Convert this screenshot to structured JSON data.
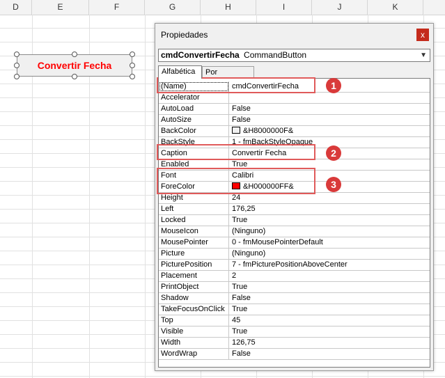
{
  "sheet": {
    "columns": [
      "D",
      "E",
      "F",
      "G",
      "H",
      "I",
      "J",
      "K"
    ],
    "button_caption": "Convertir Fecha",
    "button_color": "#ff0000"
  },
  "window": {
    "title": "Propiedades",
    "close_glyph": "x",
    "object_name": "cmdConvertirFecha",
    "object_type": "CommandButton",
    "tabs": [
      "Alfabética",
      "Por categorías"
    ]
  },
  "properties": [
    {
      "name": "(Name)",
      "value": "cmdConvertirFecha"
    },
    {
      "name": "Accelerator",
      "value": ""
    },
    {
      "name": "AutoLoad",
      "value": "False"
    },
    {
      "name": "AutoSize",
      "value": "False"
    },
    {
      "name": "BackColor",
      "value": "&H8000000F&",
      "swatch": "#f0f0f0"
    },
    {
      "name": "BackStyle",
      "value": "1 - fmBackStyleOpaque"
    },
    {
      "name": "Caption",
      "value": "Convertir Fecha"
    },
    {
      "name": "Enabled",
      "value": "True"
    },
    {
      "name": "Font",
      "value": "Calibri"
    },
    {
      "name": "ForeColor",
      "value": "&H000000FF&",
      "swatch": "#ff0000"
    },
    {
      "name": "Height",
      "value": "24"
    },
    {
      "name": "Left",
      "value": "176,25"
    },
    {
      "name": "Locked",
      "value": "True"
    },
    {
      "name": "MouseIcon",
      "value": "(Ninguno)"
    },
    {
      "name": "MousePointer",
      "value": "0 - fmMousePointerDefault"
    },
    {
      "name": "Picture",
      "value": "(Ninguno)"
    },
    {
      "name": "PicturePosition",
      "value": "7 - fmPicturePositionAboveCenter"
    },
    {
      "name": "Placement",
      "value": "2"
    },
    {
      "name": "PrintObject",
      "value": "True"
    },
    {
      "name": "Shadow",
      "value": "False"
    },
    {
      "name": "TakeFocusOnClick",
      "value": "True"
    },
    {
      "name": "Top",
      "value": "45"
    },
    {
      "name": "Visible",
      "value": "True"
    },
    {
      "name": "Width",
      "value": "126,75"
    },
    {
      "name": "WordWrap",
      "value": "False"
    }
  ],
  "annotations": [
    "1",
    "2",
    "3"
  ],
  "colors": {
    "highlight": "#e05a5a",
    "badge": "#d93a3a"
  }
}
